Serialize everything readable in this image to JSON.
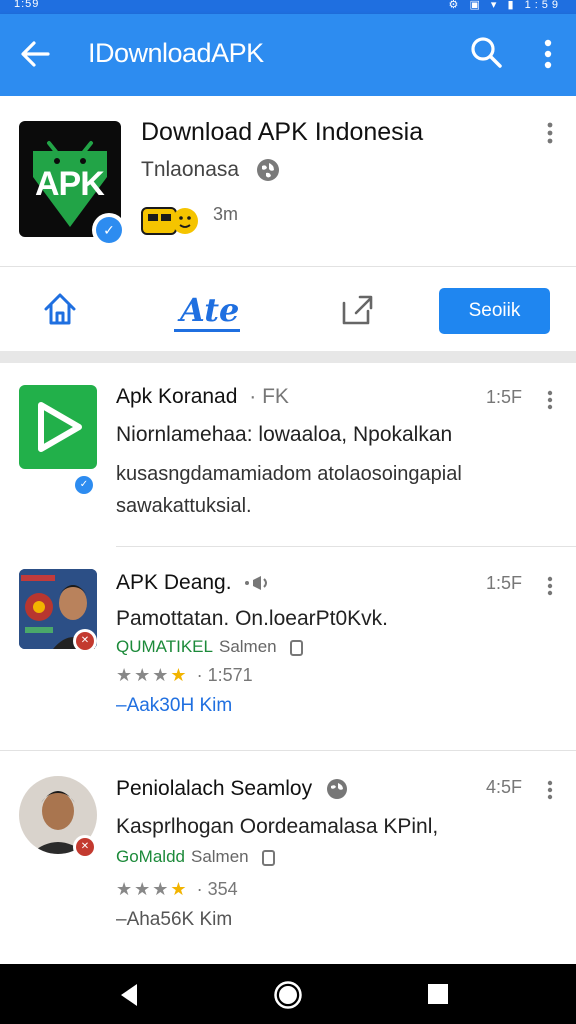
{
  "status_bar": {
    "time": "1:59",
    "icons": "⚙ ▣ ▾ ▮ 1:59"
  },
  "app_bar": {
    "title": "IDownloadAPK"
  },
  "header": {
    "logo_text": "APK",
    "title": "Download APK Indonesia",
    "subtitle": "Tnlaonasa",
    "count": "3m"
  },
  "tabs": {
    "active_label": "Ate",
    "button_label": "Seoiik"
  },
  "feed": [
    {
      "title": "Apk Koranad",
      "tag": "· FK",
      "time": "1:5F",
      "line1": "Niornlamehaa: lowaaloa, Npokalkan",
      "line2": "kusasngdamamiadom atolaosoingapial",
      "line3": "sawakattuksial."
    },
    {
      "title": "APK Deang.",
      "time": "1:5F",
      "line1": "Pamottatan. On.loearPt0Kvk.",
      "source": "QUMATIKEL",
      "source_gray": "Salmen",
      "rating": "1:571",
      "link": "–Aak30H  Kim"
    },
    {
      "title": "Peniolalach Seamloy",
      "time": "4:5F",
      "line1": "Kasprlhogan Oordeamalasa KPinl,",
      "source": "GoMaldd",
      "source_gray": "Salmen",
      "rating": "354",
      "link": "–Aha56K  Kim"
    }
  ],
  "colors": {
    "app_bar": "#2d8cf0",
    "accent": "#1f6fe0",
    "logo_green": "#22a447",
    "star_gold": "#f2b400"
  }
}
